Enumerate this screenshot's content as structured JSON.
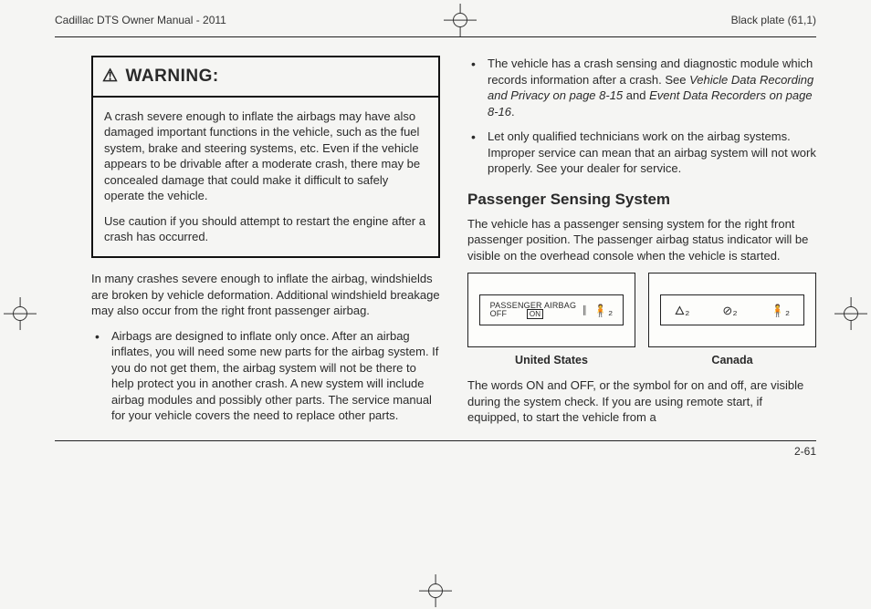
{
  "header": {
    "left": "Cadillac DTS Owner Manual - 2011",
    "right": "Black plate (61,1)"
  },
  "warning": {
    "title": "WARNING:",
    "p1": "A crash severe enough to inflate the airbags may have also damaged important functions in the vehicle, such as the fuel system, brake and steering systems, etc. Even if the vehicle appears to be drivable after a moderate crash, there may be concealed damage that could make it difficult to safely operate the vehicle.",
    "p2": "Use caution if you should attempt to restart the engine after a crash has occurred."
  },
  "col1": {
    "p1": "In many crashes severe enough to inflate the airbag, windshields are broken by vehicle deformation. Additional windshield breakage may also occur from the right front passenger airbag.",
    "b1": "Airbags are designed to inflate only once. After an airbag inflates, you will need some new parts for the airbag system. If you do not get them, the airbag system will not be there to help protect you in another crash. A new system will include airbag modules and possibly other parts. The service manual for your vehicle covers the need to replace other parts."
  },
  "col2": {
    "b2a": "The vehicle has a crash sensing and diagnostic module which records information after a crash. See ",
    "b2b": "Vehicle Data Recording and Privacy on page 8-15",
    "b2c": " and ",
    "b2d": "Event Data Recorders on page 8-16",
    "b2e": ".",
    "b3": "Let only qualified technicians work on the airbag systems. Improper service can mean that an airbag system will not work properly. See your dealer for service.",
    "h1": "Passenger Sensing System",
    "p1": "The vehicle has a passenger sensing system for the right front passenger position. The passenger airbag status indicator will be visible on the overhead console when the vehicle is started.",
    "cap_us": "United States",
    "cap_ca": "Canada",
    "ind_us_l1": "PASSENGER AIRBAG",
    "ind_us_off": "OFF",
    "ind_us_on": "ON",
    "p2": "The words ON and OFF, or the symbol for on and off, are visible during the system check. If you are using remote start, if equipped, to start the vehicle from a"
  },
  "footer": {
    "page": "2-61"
  }
}
